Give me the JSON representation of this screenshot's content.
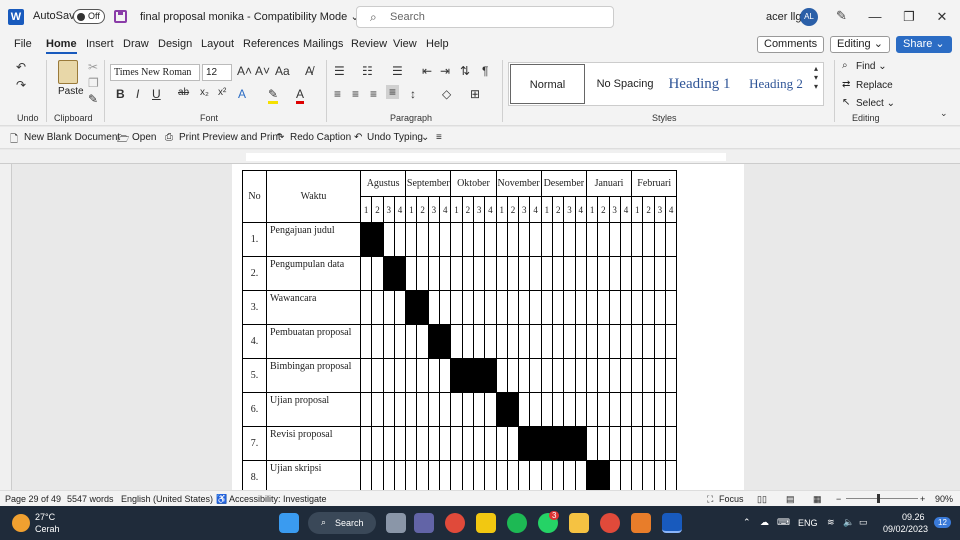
{
  "titlebar": {
    "app_icon": "W",
    "autosave_label": "AutoSave",
    "autosave_state": "Off",
    "doc_title": "final proposal monika  -  Compatibility Mode ⌄",
    "search_placeholder": "Search",
    "user_name": "acer llg",
    "user_initials": "AL",
    "minimize": "—",
    "restore": "❐",
    "close": "✕"
  },
  "tabs": [
    "File",
    "Home",
    "Insert",
    "Draw",
    "Design",
    "Layout",
    "References",
    "Mailings",
    "Review",
    "View",
    "Help"
  ],
  "tab_buttons": {
    "comments": "Comments",
    "editing": "Editing ⌄",
    "share": "Share ⌄"
  },
  "ribbon": {
    "groups": {
      "undo": "Undo",
      "clipboard": "Clipboard",
      "font": "Font",
      "paragraph": "Paragraph",
      "styles": "Styles",
      "editing": "Editing"
    },
    "paste_label": "Paste",
    "font_name": "Times New Roman",
    "font_size": "12",
    "styles": [
      "Normal",
      "No Spacing",
      "Heading 1",
      "Heading 2"
    ],
    "editing_items": [
      "Find ⌄",
      "Replace",
      "Select ⌄"
    ]
  },
  "qat": {
    "new_doc": "New Blank Document",
    "open": "Open",
    "print_preview": "Print Preview and Print",
    "redo": "Redo Caption",
    "undo": "Undo Typing"
  },
  "table": {
    "header_no": "No",
    "header_waktu": "Waktu",
    "months": [
      "Agustus",
      "September",
      "Oktober",
      "November",
      "Desember",
      "Januari",
      "Februari"
    ],
    "week_labels": [
      "1",
      "2",
      "3",
      "4"
    ],
    "rows": [
      {
        "no": "1.",
        "activity": "Pengajuan judul",
        "filled": [
          0,
          1
        ]
      },
      {
        "no": "2.",
        "activity": "Pengumpulan data",
        "filled": [
          2,
          3
        ]
      },
      {
        "no": "3.",
        "activity": "Wawancara",
        "filled": [
          4,
          5
        ]
      },
      {
        "no": "4.",
        "activity": "Pembuatan proposal",
        "filled": [
          6,
          7
        ]
      },
      {
        "no": "5.",
        "activity": "Bimbingan proposal",
        "filled": [
          8,
          9,
          10,
          11
        ]
      },
      {
        "no": "6.",
        "activity": "Ujian proposal",
        "filled": [
          12,
          13
        ]
      },
      {
        "no": "7.",
        "activity": "Revisi proposal",
        "filled": [
          14,
          15,
          16,
          17,
          18,
          19
        ]
      },
      {
        "no": "8.",
        "activity": "Ujian skripsi",
        "filled": [
          20,
          21
        ]
      }
    ]
  },
  "statusbar": {
    "page": "Page 29 of 49",
    "words": "5547 words",
    "language": "English (United States)",
    "accessibility": "Accessibility: Investigate",
    "focus": "Focus",
    "zoom": "90%"
  },
  "taskbar": {
    "weather_temp": "27°C",
    "weather_desc": "Cerah",
    "search": "Search",
    "lang": "ENG",
    "time": "09.26",
    "date": "09/02/2023",
    "notifications": "12",
    "whatsapp_badge": "3"
  }
}
